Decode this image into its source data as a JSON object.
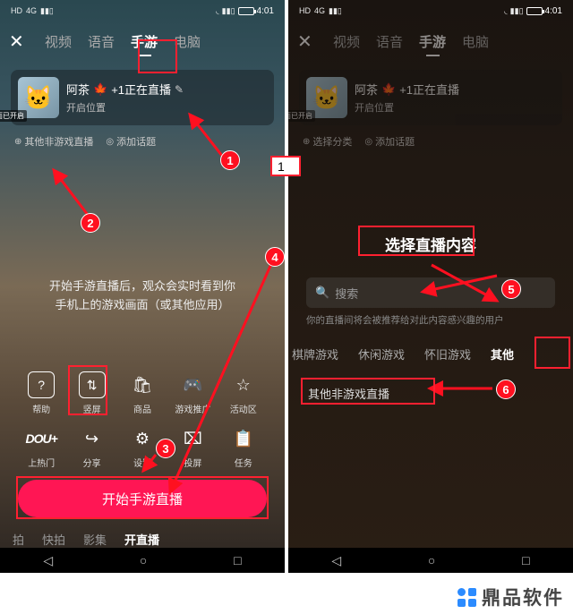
{
  "status": {
    "hd": "HD",
    "net": "4G",
    "time": "4:01"
  },
  "nav": {
    "close": "✕",
    "tabs": [
      "视频",
      "语音",
      "手游",
      "电脑"
    ],
    "active": "手游"
  },
  "room": {
    "avatar_tag": "截图封面已开启",
    "name": "阿茶",
    "badge": "🍁",
    "suffix": "+1正在直播",
    "edit": "✎",
    "subtitle": "开启位置"
  },
  "tags_left": {
    "a": "其他非游戏直播",
    "b": "添加话题"
  },
  "tags_right": {
    "a": "选择分类",
    "b": "添加话题"
  },
  "desc": "开始手游直播后，观众会实时看到你\n手机上的游戏画面（或其他应用）",
  "tools_row1": [
    {
      "icon": "?",
      "label": "帮助"
    },
    {
      "icon": "⇅",
      "label": "竖屏"
    },
    {
      "icon": "🛍",
      "label": "商品"
    },
    {
      "icon": "🎮",
      "label": "游戏推广"
    },
    {
      "icon": "☆",
      "label": "活动区"
    }
  ],
  "tools_row2": [
    {
      "icon": "DOU+",
      "label": "上热门"
    },
    {
      "icon": "↪",
      "label": "分享"
    },
    {
      "icon": "⚙",
      "label": "设置"
    },
    {
      "icon": "⌧",
      "label": "投屏"
    },
    {
      "icon": "📋",
      "label": "任务"
    }
  ],
  "start_button": "开始手游直播",
  "bottom_tabs": [
    "拍",
    "快拍",
    "影集",
    "开直播"
  ],
  "bottom_active": "开直播",
  "sysnav": {
    "back": "◁",
    "home": "○",
    "recent": "□"
  },
  "modal": {
    "title": "选择直播内容",
    "search_placeholder": "搜索",
    "hint": "你的直播间将会被推荐给对此内容感兴趣的用户",
    "categories": [
      "棋牌游戏",
      "休闲游戏",
      "怀旧游戏",
      "其他"
    ],
    "cat_active": "其他",
    "item": "其他非游戏直播"
  },
  "annotations": {
    "labels": [
      "1",
      "2",
      "3",
      "4",
      "5",
      "6"
    ],
    "step": "1"
  },
  "branding": "鼎品软件"
}
